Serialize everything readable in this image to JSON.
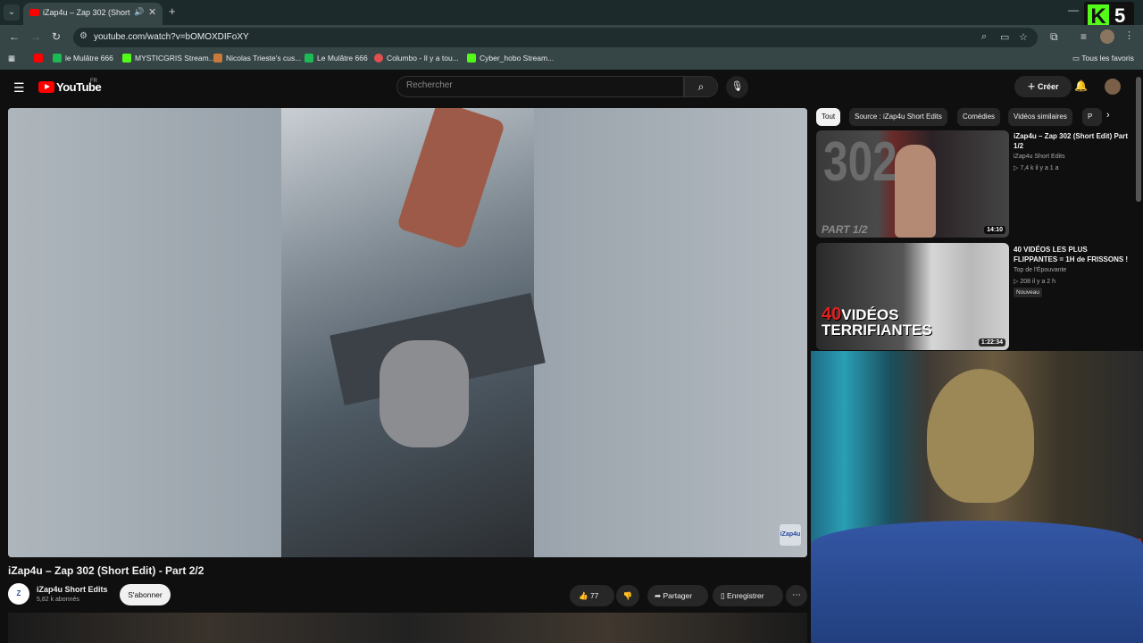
{
  "browser": {
    "tab_title": "iZap4u – Zap 302 (Short Edit",
    "url": "youtube.com/watch?v=bOMOXDIFoXY",
    "overlay_logo_letter": "K",
    "overlay_logo_number": "5",
    "bookmarks": [
      {
        "label": "le Mulâtre 666",
        "color": "#1db954"
      },
      {
        "label": "MYSTICGRIS Stream...",
        "color": "#53fc18"
      },
      {
        "label": "Nicolas Trieste's cus...",
        "color": "#c97a3a"
      },
      {
        "label": "Le Mulâtre 666",
        "color": "#1db954"
      },
      {
        "label": "Columbo - Il y a tou...",
        "color": "#e05050"
      },
      {
        "label": "Cyber_hobo Stream...",
        "color": "#53fc18"
      }
    ],
    "all_bookmarks": "Tous les favoris"
  },
  "youtube": {
    "logo_text": "YouTube",
    "country_code": "FR",
    "search_placeholder": "Rechercher",
    "create_label": "Créer"
  },
  "video": {
    "title": "iZap4u – Zap 302 (Short Edit) - Part 2/2",
    "channel_name": "iZap4u Short Edits",
    "subscribers": "5,82 k abonnés",
    "subscribe_label": "S'abonner",
    "likes": "77",
    "share_label": "Partager",
    "save_label": "Enregistrer",
    "watermark": "iZap4u",
    "channel_avatar_text": "Z"
  },
  "chips": [
    "Tout",
    "Source : iZap4u Short Edits",
    "Comédies",
    "Vidéos similaires",
    "P"
  ],
  "related": [
    {
      "title": "iZap4u – Zap 302 (Short Edit) Part 1/2",
      "channel": "iZap4u Short Edits",
      "meta": "▷ 7,4 k   il y a 1 a",
      "duration": "14:10",
      "thumb_big_text": "302",
      "thumb_sub_text": "PART 1/2"
    },
    {
      "title": "40 VIDÉOS LES PLUS FLIPPANTES = 1H de FRISSONS !",
      "channel": "Top de l'Épouvante",
      "meta": "▷ 208   il y a 2 h",
      "badge": "Nouveau",
      "duration": "1:22:34",
      "thumb_num": "40",
      "thumb_word1": "VIDÉOS",
      "thumb_word2": "TERRIFIANTES"
    }
  ]
}
